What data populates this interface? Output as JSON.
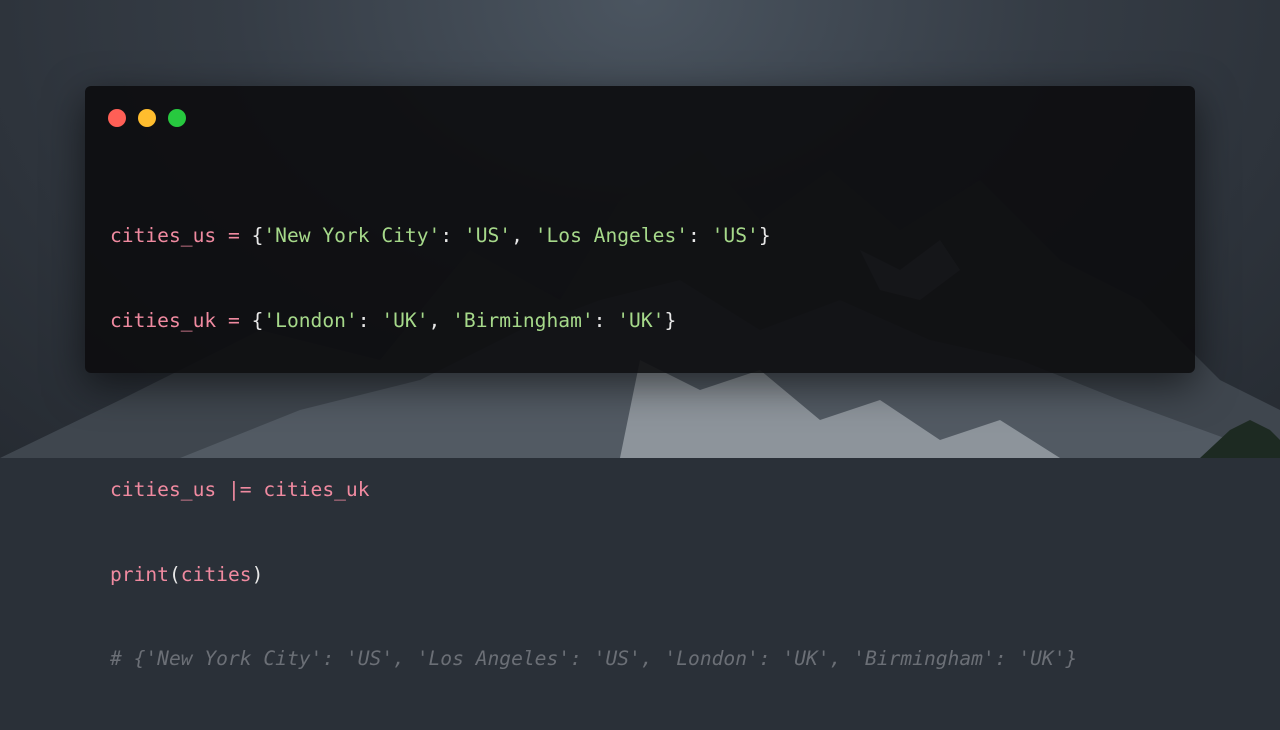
{
  "window": {
    "traffic_lights": [
      {
        "name": "close",
        "color": "#ff5f56"
      },
      {
        "name": "minimize",
        "color": "#ffbd2e"
      },
      {
        "name": "maximize",
        "color": "#27c93f"
      }
    ]
  },
  "code": {
    "line1": {
      "var": "cities_us",
      "op": " = ",
      "open": "{",
      "k1": "'New York City'",
      "c1": ": ",
      "v1": "'US'",
      "sep1": ", ",
      "k2": "'Los Angeles'",
      "c2": ": ",
      "v2": "'US'",
      "close": "}"
    },
    "line2": {
      "var": "cities_uk",
      "op": " = ",
      "open": "{",
      "k1": "'London'",
      "c1": ": ",
      "v1": "'UK'",
      "sep1": ", ",
      "k2": "'Birmingham'",
      "c2": ": ",
      "v2": "'UK'",
      "close": "}"
    },
    "line4": {
      "var": "cities_us",
      "op": " |= ",
      "rhs": "cities_uk"
    },
    "line5": {
      "fn": "print",
      "open": "(",
      "arg": "cities",
      "close": ")"
    },
    "line6": {
      "comment": "# {'New York City': 'US', 'Los Angeles': 'US', 'London': 'UK', 'Birmingham': 'UK'}"
    }
  },
  "colors": {
    "variable": "#f08aa0",
    "string": "#a6d98a",
    "comment": "#6b6f76",
    "punctuation": "#e8e8e8",
    "window_bg": "#0c0c0e"
  }
}
